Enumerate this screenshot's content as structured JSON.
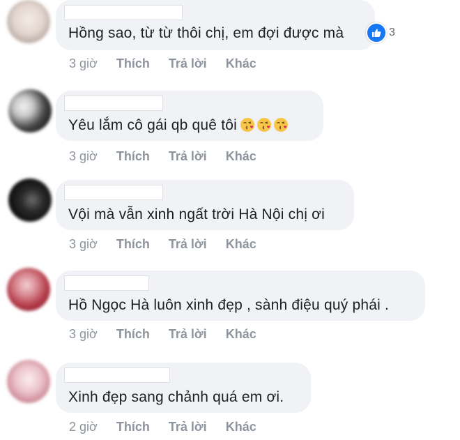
{
  "comments": [
    {
      "text": "Hồng sao, từ từ thôi chị, em đợi được mà",
      "reaction_icon": "like-icon",
      "reaction_count": "3",
      "time": "3 giờ",
      "like": "Thích",
      "reply": "Trả lời",
      "other": "Khác"
    },
    {
      "text": "Yêu lắm cô gái qb quê tôi",
      "emojis": [
        "kissing-face-icon",
        "kissing-face-icon",
        "kissing-face-icon"
      ],
      "time": "3 giờ",
      "like": "Thích",
      "reply": "Trả lời",
      "other": "Khác"
    },
    {
      "text": "Vội mà vẫn xinh ngất trời Hà Nội chị ơi",
      "time": "3 giờ",
      "like": "Thích",
      "reply": "Trả lời",
      "other": "Khác"
    },
    {
      "text": "Hồ Ngọc Hà luôn xinh đẹp , sành điệu quý phái .",
      "time": "3 giờ",
      "like": "Thích",
      "reply": "Trả lời",
      "other": "Khác"
    },
    {
      "text": "Xinh đẹp sang chảnh quá em ơi.",
      "time": "2 giờ",
      "like": "Thích",
      "reply": "Trả lời",
      "other": "Khác"
    }
  ],
  "colors": {
    "bubble": "#f0f2f5",
    "text": "#1c1e21",
    "meta": "#8d949e",
    "like_blue": "#1877f2"
  }
}
